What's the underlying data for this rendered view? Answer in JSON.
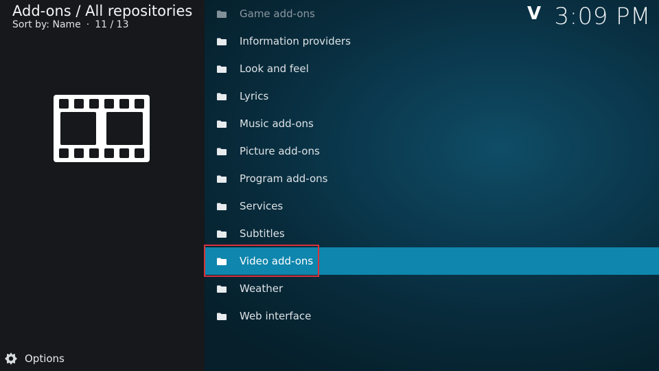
{
  "header": {
    "title": "Add-ons / All repositories",
    "sort_label": "Sort by: Name",
    "separator": "·",
    "position": "11 / 13"
  },
  "clock": {
    "time": "3:09 PM"
  },
  "letter_jump": "V",
  "options": {
    "label": "Options",
    "icon": "options-gear-icon"
  },
  "category_icon": "film-strip-icon",
  "list": {
    "items": [
      {
        "label": "Game add-ons",
        "icon": "folder-icon",
        "dim": true
      },
      {
        "label": "Information providers",
        "icon": "folder-icon"
      },
      {
        "label": "Look and feel",
        "icon": "folder-icon"
      },
      {
        "label": "Lyrics",
        "icon": "folder-icon"
      },
      {
        "label": "Music add-ons",
        "icon": "folder-icon"
      },
      {
        "label": "Picture add-ons",
        "icon": "folder-icon"
      },
      {
        "label": "Program add-ons",
        "icon": "folder-icon"
      },
      {
        "label": "Services",
        "icon": "folder-icon"
      },
      {
        "label": "Subtitles",
        "icon": "folder-icon"
      },
      {
        "label": "Video add-ons",
        "icon": "folder-icon",
        "selected": true
      },
      {
        "label": "Weather",
        "icon": "folder-icon"
      },
      {
        "label": "Web interface",
        "icon": "folder-icon"
      }
    ]
  },
  "colors": {
    "selection": "#0f86ad",
    "annotation_box": "#d8323c",
    "left_panel": "#16181b",
    "right_panel": "#0b3a50"
  }
}
